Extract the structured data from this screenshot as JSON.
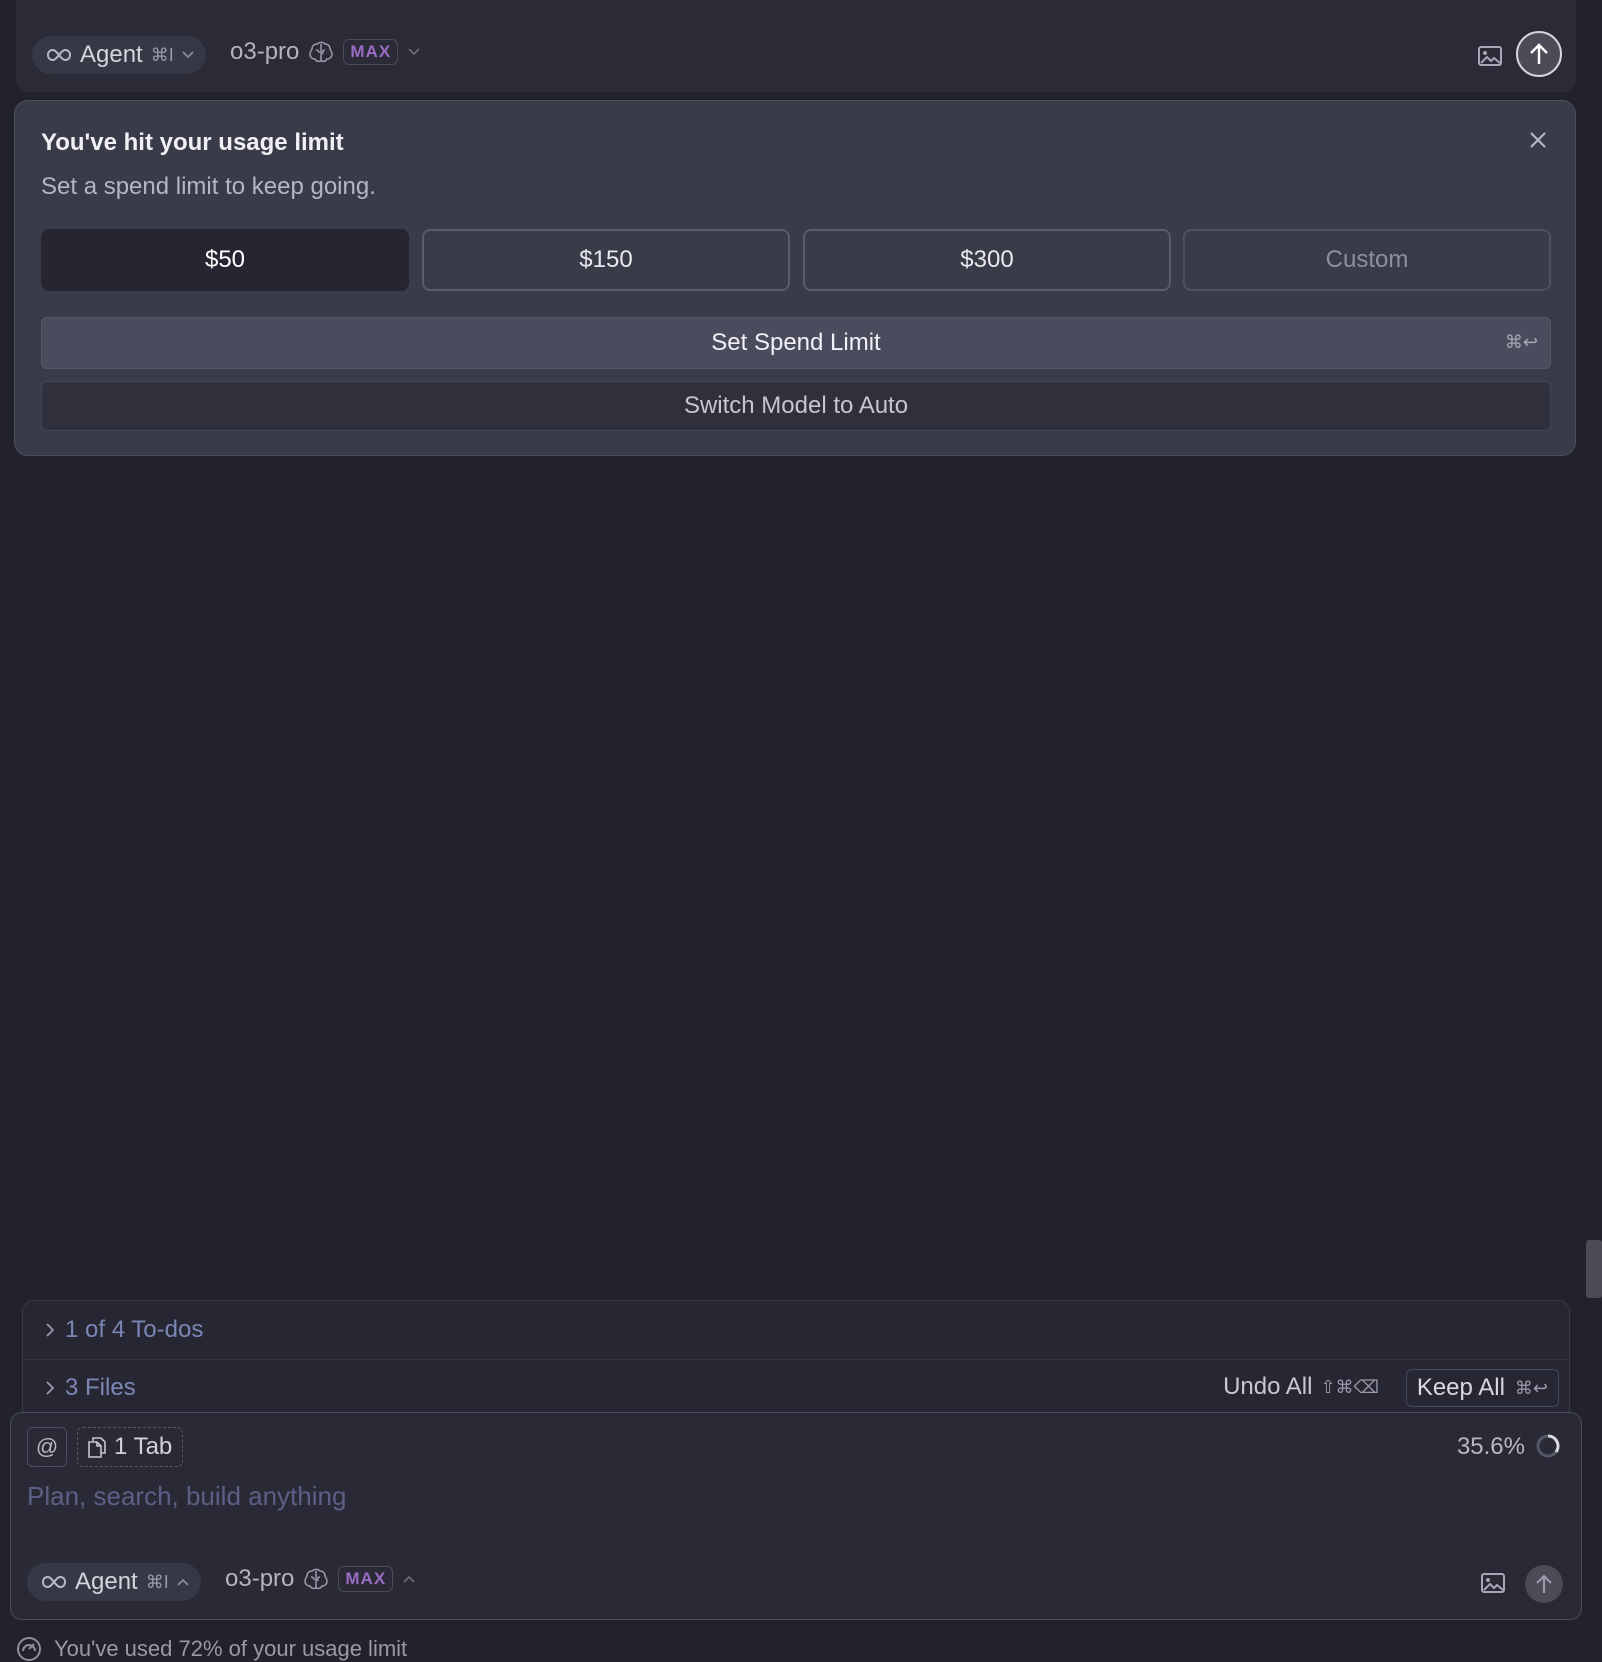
{
  "top_composer": {
    "mode_label": "Agent",
    "mode_shortcut": "⌘I",
    "model_name": "o3-pro",
    "max_badge": "MAX"
  },
  "usage_dialog": {
    "title": "You've hit your usage limit",
    "subtitle": "Set a spend limit to keep going.",
    "amounts": [
      "$50",
      "$150",
      "$300",
      "Custom"
    ],
    "selected_amount": "$50",
    "primary_label": "Set Spend Limit",
    "primary_shortcut": "⌘↩",
    "secondary_label": "Switch Model to Auto"
  },
  "review": {
    "todos_label": "1 of 4 To-dos",
    "files_label": "3 Files",
    "undo_label": "Undo All",
    "undo_shortcut": "⇧⌘⌫",
    "keep_label": "Keep All",
    "keep_shortcut": "⌘↩"
  },
  "composer": {
    "at_symbol": "@",
    "tab_chip": "1 Tab",
    "context_usage": "35.6%",
    "placeholder": "Plan, search, build anything",
    "mode_label": "Agent",
    "mode_shortcut": "⌘I",
    "model_name": "o3-pro",
    "max_badge": "MAX"
  },
  "footer": {
    "usage_text": "You've used 72% of your usage limit"
  },
  "colors": {
    "background": "#22222c",
    "dialog_bg": "#393b49",
    "accent_max": "#9a6cc4",
    "link_blue": "#7b86b4"
  },
  "icons": [
    "infinity-icon",
    "chevron-down-icon",
    "brain-icon",
    "image-icon",
    "arrow-up-icon",
    "close-icon",
    "chevron-right-icon",
    "files-icon",
    "spinner-icon",
    "gauge-icon"
  ]
}
